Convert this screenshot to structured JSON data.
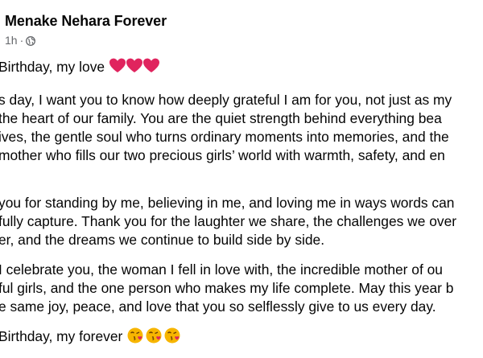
{
  "post": {
    "author": "Menake Nehara Forever",
    "time": "1h",
    "dot": "·",
    "privacy_icon": "globe-icon",
    "greeting": "Birthday, my love",
    "greeting_emoji": "heart-icon",
    "paragraph1": [
      "s day, I want you to know how deeply grateful I am for you, not just as my",
      "the heart of our family. You are the quiet strength behind everything bea",
      "ives, the gentle soul who turns ordinary moments into memories, and the",
      "mother who fills our two precious girls’ world with warmth, safety, and en"
    ],
    "paragraph2": [
      "you for standing by me, believing in me, and loving me in ways words can",
      "fully capture. Thank you for the laughter we share, the challenges we over",
      "er, and the dreams we continue to build side by side."
    ],
    "paragraph3": [
      "I celebrate you, the woman I fell in love with, the incredible mother of ou",
      "ful girls, and the one person who makes my life complete. May this year b",
      "e same joy, peace, and love that you so selflessly give to us every day."
    ],
    "closing": "Birthday, my forever",
    "closing_emoji": "kiss-face-icon",
    "colors": {
      "text": "#050505",
      "meta": "#65676b",
      "heart": "#e0245e",
      "kiss_face": "#f7b500"
    }
  }
}
